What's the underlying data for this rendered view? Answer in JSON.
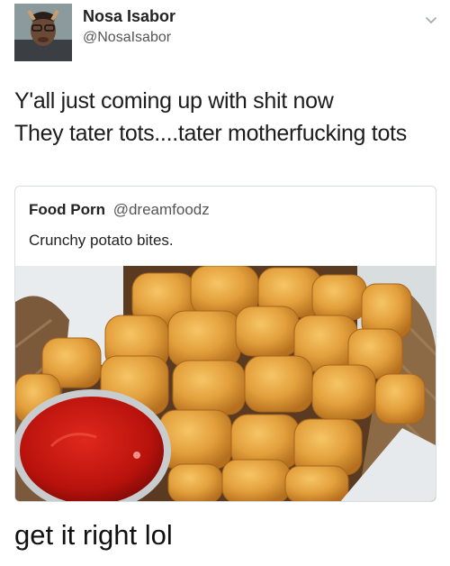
{
  "author": {
    "display_name": "Nosa Isabor",
    "handle": "@NosaIsabor"
  },
  "tweet": {
    "lines": [
      "Y'all just coming up with shit now",
      "They tater tots....tater motherfucking tots"
    ]
  },
  "quoted_tweet": {
    "display_name": "Food Porn",
    "handle": "@dreamfoodz",
    "text": "Crunchy potato bites."
  },
  "caption": "get it right lol",
  "icons": {
    "menu": "chevron-down-icon"
  },
  "colors": {
    "text": "#14171a",
    "muted": "#555555",
    "card_border": "#d8dde1",
    "tot_gold": "#e0a23c",
    "ketchup": "#c0150f"
  }
}
